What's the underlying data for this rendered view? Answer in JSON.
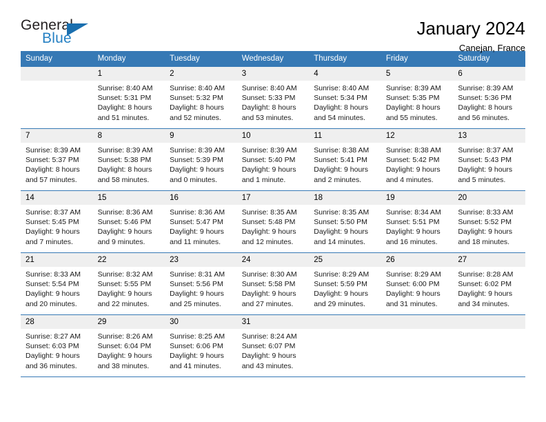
{
  "brand": {
    "name_top": "General",
    "name_bottom": "Blue",
    "triangle_color": "#1a6faf",
    "blue_color": "#2580c3"
  },
  "header": {
    "title": "January 2024",
    "subtitle": "Canejan, France"
  },
  "theme": {
    "header_row_bg": "#3679b5",
    "daynum_bg": "#efefef",
    "row_divider": "#3679b5"
  },
  "weekdays": [
    "Sunday",
    "Monday",
    "Tuesday",
    "Wednesday",
    "Thursday",
    "Friday",
    "Saturday"
  ],
  "weeks": [
    [
      {
        "day": "",
        "empty": true,
        "sunrise": "",
        "sunset": "",
        "daylight_1": "",
        "daylight_2": ""
      },
      {
        "day": "1",
        "sunrise": "Sunrise: 8:40 AM",
        "sunset": "Sunset: 5:31 PM",
        "daylight_1": "Daylight: 8 hours",
        "daylight_2": "and 51 minutes."
      },
      {
        "day": "2",
        "sunrise": "Sunrise: 8:40 AM",
        "sunset": "Sunset: 5:32 PM",
        "daylight_1": "Daylight: 8 hours",
        "daylight_2": "and 52 minutes."
      },
      {
        "day": "3",
        "sunrise": "Sunrise: 8:40 AM",
        "sunset": "Sunset: 5:33 PM",
        "daylight_1": "Daylight: 8 hours",
        "daylight_2": "and 53 minutes."
      },
      {
        "day": "4",
        "sunrise": "Sunrise: 8:40 AM",
        "sunset": "Sunset: 5:34 PM",
        "daylight_1": "Daylight: 8 hours",
        "daylight_2": "and 54 minutes."
      },
      {
        "day": "5",
        "sunrise": "Sunrise: 8:39 AM",
        "sunset": "Sunset: 5:35 PM",
        "daylight_1": "Daylight: 8 hours",
        "daylight_2": "and 55 minutes."
      },
      {
        "day": "6",
        "sunrise": "Sunrise: 8:39 AM",
        "sunset": "Sunset: 5:36 PM",
        "daylight_1": "Daylight: 8 hours",
        "daylight_2": "and 56 minutes."
      }
    ],
    [
      {
        "day": "7",
        "sunrise": "Sunrise: 8:39 AM",
        "sunset": "Sunset: 5:37 PM",
        "daylight_1": "Daylight: 8 hours",
        "daylight_2": "and 57 minutes."
      },
      {
        "day": "8",
        "sunrise": "Sunrise: 8:39 AM",
        "sunset": "Sunset: 5:38 PM",
        "daylight_1": "Daylight: 8 hours",
        "daylight_2": "and 58 minutes."
      },
      {
        "day": "9",
        "sunrise": "Sunrise: 8:39 AM",
        "sunset": "Sunset: 5:39 PM",
        "daylight_1": "Daylight: 9 hours",
        "daylight_2": "and 0 minutes."
      },
      {
        "day": "10",
        "sunrise": "Sunrise: 8:39 AM",
        "sunset": "Sunset: 5:40 PM",
        "daylight_1": "Daylight: 9 hours",
        "daylight_2": "and 1 minute."
      },
      {
        "day": "11",
        "sunrise": "Sunrise: 8:38 AM",
        "sunset": "Sunset: 5:41 PM",
        "daylight_1": "Daylight: 9 hours",
        "daylight_2": "and 2 minutes."
      },
      {
        "day": "12",
        "sunrise": "Sunrise: 8:38 AM",
        "sunset": "Sunset: 5:42 PM",
        "daylight_1": "Daylight: 9 hours",
        "daylight_2": "and 4 minutes."
      },
      {
        "day": "13",
        "sunrise": "Sunrise: 8:37 AM",
        "sunset": "Sunset: 5:43 PM",
        "daylight_1": "Daylight: 9 hours",
        "daylight_2": "and 5 minutes."
      }
    ],
    [
      {
        "day": "14",
        "sunrise": "Sunrise: 8:37 AM",
        "sunset": "Sunset: 5:45 PM",
        "daylight_1": "Daylight: 9 hours",
        "daylight_2": "and 7 minutes."
      },
      {
        "day": "15",
        "sunrise": "Sunrise: 8:36 AM",
        "sunset": "Sunset: 5:46 PM",
        "daylight_1": "Daylight: 9 hours",
        "daylight_2": "and 9 minutes."
      },
      {
        "day": "16",
        "sunrise": "Sunrise: 8:36 AM",
        "sunset": "Sunset: 5:47 PM",
        "daylight_1": "Daylight: 9 hours",
        "daylight_2": "and 11 minutes."
      },
      {
        "day": "17",
        "sunrise": "Sunrise: 8:35 AM",
        "sunset": "Sunset: 5:48 PM",
        "daylight_1": "Daylight: 9 hours",
        "daylight_2": "and 12 minutes."
      },
      {
        "day": "18",
        "sunrise": "Sunrise: 8:35 AM",
        "sunset": "Sunset: 5:50 PM",
        "daylight_1": "Daylight: 9 hours",
        "daylight_2": "and 14 minutes."
      },
      {
        "day": "19",
        "sunrise": "Sunrise: 8:34 AM",
        "sunset": "Sunset: 5:51 PM",
        "daylight_1": "Daylight: 9 hours",
        "daylight_2": "and 16 minutes."
      },
      {
        "day": "20",
        "sunrise": "Sunrise: 8:33 AM",
        "sunset": "Sunset: 5:52 PM",
        "daylight_1": "Daylight: 9 hours",
        "daylight_2": "and 18 minutes."
      }
    ],
    [
      {
        "day": "21",
        "sunrise": "Sunrise: 8:33 AM",
        "sunset": "Sunset: 5:54 PM",
        "daylight_1": "Daylight: 9 hours",
        "daylight_2": "and 20 minutes."
      },
      {
        "day": "22",
        "sunrise": "Sunrise: 8:32 AM",
        "sunset": "Sunset: 5:55 PM",
        "daylight_1": "Daylight: 9 hours",
        "daylight_2": "and 22 minutes."
      },
      {
        "day": "23",
        "sunrise": "Sunrise: 8:31 AM",
        "sunset": "Sunset: 5:56 PM",
        "daylight_1": "Daylight: 9 hours",
        "daylight_2": "and 25 minutes."
      },
      {
        "day": "24",
        "sunrise": "Sunrise: 8:30 AM",
        "sunset": "Sunset: 5:58 PM",
        "daylight_1": "Daylight: 9 hours",
        "daylight_2": "and 27 minutes."
      },
      {
        "day": "25",
        "sunrise": "Sunrise: 8:29 AM",
        "sunset": "Sunset: 5:59 PM",
        "daylight_1": "Daylight: 9 hours",
        "daylight_2": "and 29 minutes."
      },
      {
        "day": "26",
        "sunrise": "Sunrise: 8:29 AM",
        "sunset": "Sunset: 6:00 PM",
        "daylight_1": "Daylight: 9 hours",
        "daylight_2": "and 31 minutes."
      },
      {
        "day": "27",
        "sunrise": "Sunrise: 8:28 AM",
        "sunset": "Sunset: 6:02 PM",
        "daylight_1": "Daylight: 9 hours",
        "daylight_2": "and 34 minutes."
      }
    ],
    [
      {
        "day": "28",
        "sunrise": "Sunrise: 8:27 AM",
        "sunset": "Sunset: 6:03 PM",
        "daylight_1": "Daylight: 9 hours",
        "daylight_2": "and 36 minutes."
      },
      {
        "day": "29",
        "sunrise": "Sunrise: 8:26 AM",
        "sunset": "Sunset: 6:04 PM",
        "daylight_1": "Daylight: 9 hours",
        "daylight_2": "and 38 minutes."
      },
      {
        "day": "30",
        "sunrise": "Sunrise: 8:25 AM",
        "sunset": "Sunset: 6:06 PM",
        "daylight_1": "Daylight: 9 hours",
        "daylight_2": "and 41 minutes."
      },
      {
        "day": "31",
        "sunrise": "Sunrise: 8:24 AM",
        "sunset": "Sunset: 6:07 PM",
        "daylight_1": "Daylight: 9 hours",
        "daylight_2": "and 43 minutes."
      },
      {
        "day": "",
        "empty": true,
        "sunrise": "",
        "sunset": "",
        "daylight_1": "",
        "daylight_2": ""
      },
      {
        "day": "",
        "empty": true,
        "sunrise": "",
        "sunset": "",
        "daylight_1": "",
        "daylight_2": ""
      },
      {
        "day": "",
        "empty": true,
        "sunrise": "",
        "sunset": "",
        "daylight_1": "",
        "daylight_2": ""
      }
    ]
  ]
}
